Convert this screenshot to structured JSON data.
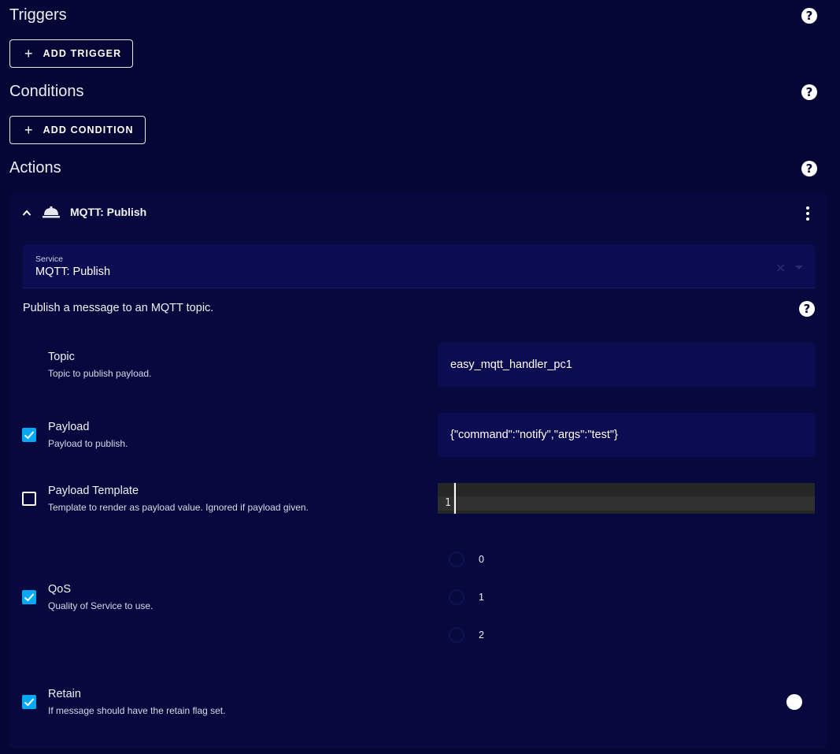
{
  "triggers": {
    "title": "Triggers",
    "add_label": "ADD TRIGGER"
  },
  "conditions": {
    "title": "Conditions",
    "add_label": "ADD CONDITION"
  },
  "actions": {
    "title": "Actions"
  },
  "help_glyph": "?",
  "action_card": {
    "title": "MQTT: Publish",
    "icon": "bell-icon",
    "service": {
      "label": "Service",
      "value": "MQTT: Publish"
    },
    "description": "Publish a message to an MQTT topic.",
    "fields": {
      "topic": {
        "name": "Topic",
        "description": "Topic to publish payload.",
        "value": "easy_mqtt_handler_pc1"
      },
      "payload": {
        "name": "Payload",
        "description": "Payload to publish.",
        "value": "{\"command\":\"notify\",\"args\":\"test\"}",
        "enabled": true
      },
      "payload_template": {
        "name": "Payload Template",
        "description": "Template to render as payload value. Ignored if payload given.",
        "line_number": "1",
        "enabled": false
      },
      "qos": {
        "name": "QoS",
        "description": "Quality of Service to use.",
        "options": [
          "0",
          "1",
          "2"
        ],
        "enabled": true
      },
      "retain": {
        "name": "Retain",
        "description": "If message should have the retain flag set.",
        "enabled": true
      }
    }
  },
  "colors": {
    "background": "#050635",
    "card": "#07083d",
    "input": "#0b0c52",
    "accent": "#03a9f4"
  }
}
